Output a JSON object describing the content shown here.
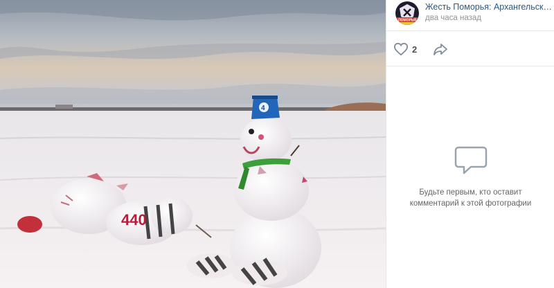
{
  "post": {
    "author": "Жесть Поморья: Архангельск Северодвинск",
    "time": "два часа назад",
    "avatar_icon": "community-avatar-icon",
    "avatar_text": "ПОМОРЬЯ"
  },
  "actions": {
    "likes": "2",
    "like_icon": "heart-icon",
    "share_icon": "share-arrow-icon"
  },
  "comments": {
    "empty_icon": "comment-bubble-icon",
    "empty_line1": "Будьте первым, кто оставит",
    "empty_line2": "комментарий к этой фотографии"
  },
  "photo": {
    "description_icon": "snowman-photo",
    "sign_text": "440",
    "bucket_text": "4"
  },
  "colors": {
    "link": "#2a5885",
    "muted": "#939393",
    "icon": "#818c99",
    "divider": "#e7e8ec"
  }
}
